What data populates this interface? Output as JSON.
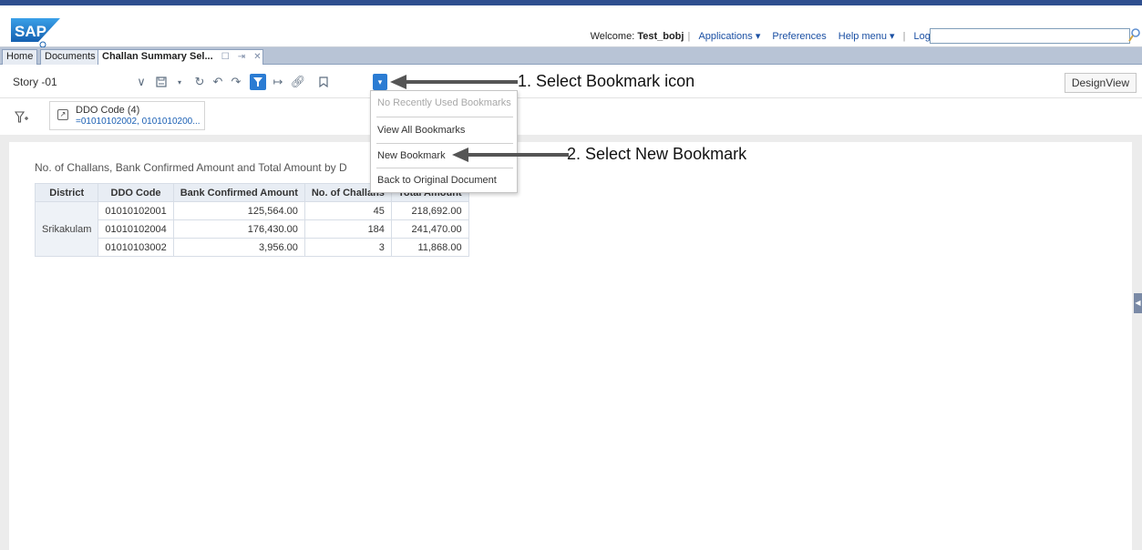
{
  "header": {
    "logo_text": "SAP",
    "welcome_label": "Welcome: ",
    "username": "Test_bobj",
    "links": {
      "applications": "Applications ▾",
      "preferences": "Preferences",
      "help_menu": "Help menu ▾",
      "log_off": "Log off"
    },
    "search_value": ""
  },
  "tabs": [
    {
      "label": "Home"
    },
    {
      "label": "Documents"
    },
    {
      "label": "Challan Summary Sel..."
    }
  ],
  "toolbar": {
    "story_name": "Story -01",
    "design_view": "DesignView"
  },
  "filter": {
    "title": "DDO Code (4)",
    "value": "=01010102002, 0101010200..."
  },
  "report": {
    "title": "No. of Challans, Bank Confirmed Amount and Total Amount by D",
    "headers": [
      "District",
      "DDO Code",
      "Bank Confirmed Amount",
      "No. of Challans",
      "Total Amount"
    ],
    "district": "Srikakulam",
    "rows": [
      {
        "ddo": "01010102001",
        "bank": "125,564.00",
        "challans": "45",
        "total": "218,692.00"
      },
      {
        "ddo": "01010102004",
        "bank": "176,430.00",
        "challans": "184",
        "total": "241,470.00"
      },
      {
        "ddo": "01010103002",
        "bank": "3,956.00",
        "challans": "3",
        "total": "11,868.00"
      }
    ]
  },
  "bookmark_menu": {
    "no_recent": "No Recently Used Bookmarks",
    "view_all": "View All Bookmarks",
    "new_bookmark": "New Bookmark",
    "back_original": "Back to Original Document"
  },
  "annotations": {
    "step1": "1. Select Bookmark icon",
    "step2": "2. Select New Bookmark"
  },
  "colors": {
    "accent": "#2b7cd3",
    "sap_blue": "#1a73c8",
    "annotation": "#555555"
  }
}
